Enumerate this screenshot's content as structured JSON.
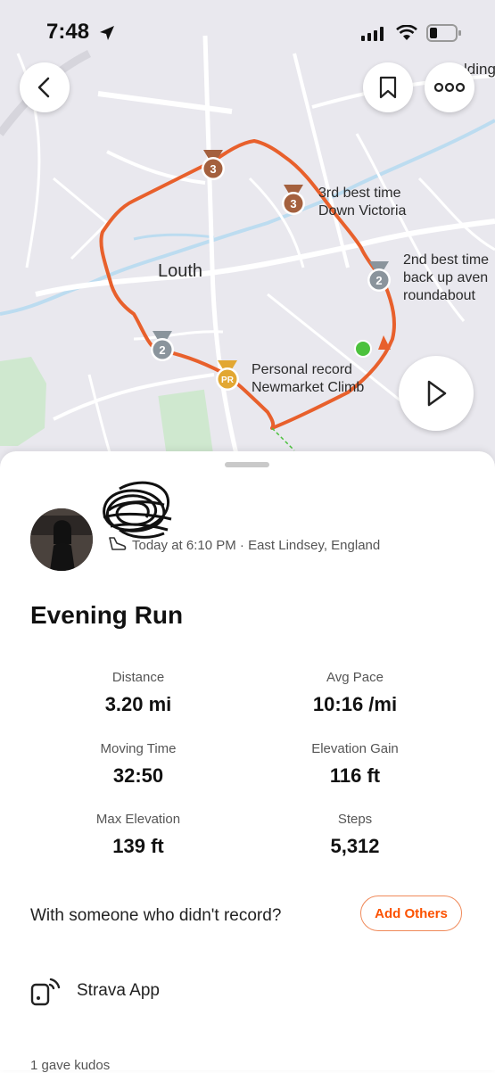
{
  "status_bar": {
    "time": "7:48"
  },
  "map": {
    "town_label": "Louth",
    "corner_label": "lding",
    "route_color": "#e8602c",
    "segments": [
      {
        "line1": "3rd best time",
        "line2": "Down Victoria",
        "rank": "3"
      },
      {
        "line1": "2nd best time",
        "line2": "back up aven",
        "line3": "roundabout",
        "rank": "2"
      },
      {
        "line1": "Personal record",
        "line2": "Newmarket Climb",
        "rank": "PR"
      }
    ],
    "medal_ranks": [
      "3",
      "3",
      "2",
      "2",
      "PR"
    ]
  },
  "activity": {
    "meta": "Today at 6:10 PM · East Lindsey, England",
    "title": "Evening Run",
    "stats": [
      {
        "label": "Distance",
        "value": "3.20 mi"
      },
      {
        "label": "Avg Pace",
        "value": "10:16 /mi"
      },
      {
        "label": "Moving Time",
        "value": "32:50"
      },
      {
        "label": "Elevation Gain",
        "value": "116 ft"
      },
      {
        "label": "Max Elevation",
        "value": "139 ft"
      },
      {
        "label": "Steps",
        "value": "5,312"
      }
    ]
  },
  "with_others": {
    "prompt": "With someone who didn't record?",
    "button": "Add Others"
  },
  "device": {
    "name": "Strava App"
  },
  "kudos": {
    "text": "1 gave kudos"
  },
  "colors": {
    "accent": "#fc5200",
    "bronze": "#a4603e",
    "silver": "#8a949c",
    "gold": "#e2a732",
    "start_dot": "#4cc23d"
  }
}
